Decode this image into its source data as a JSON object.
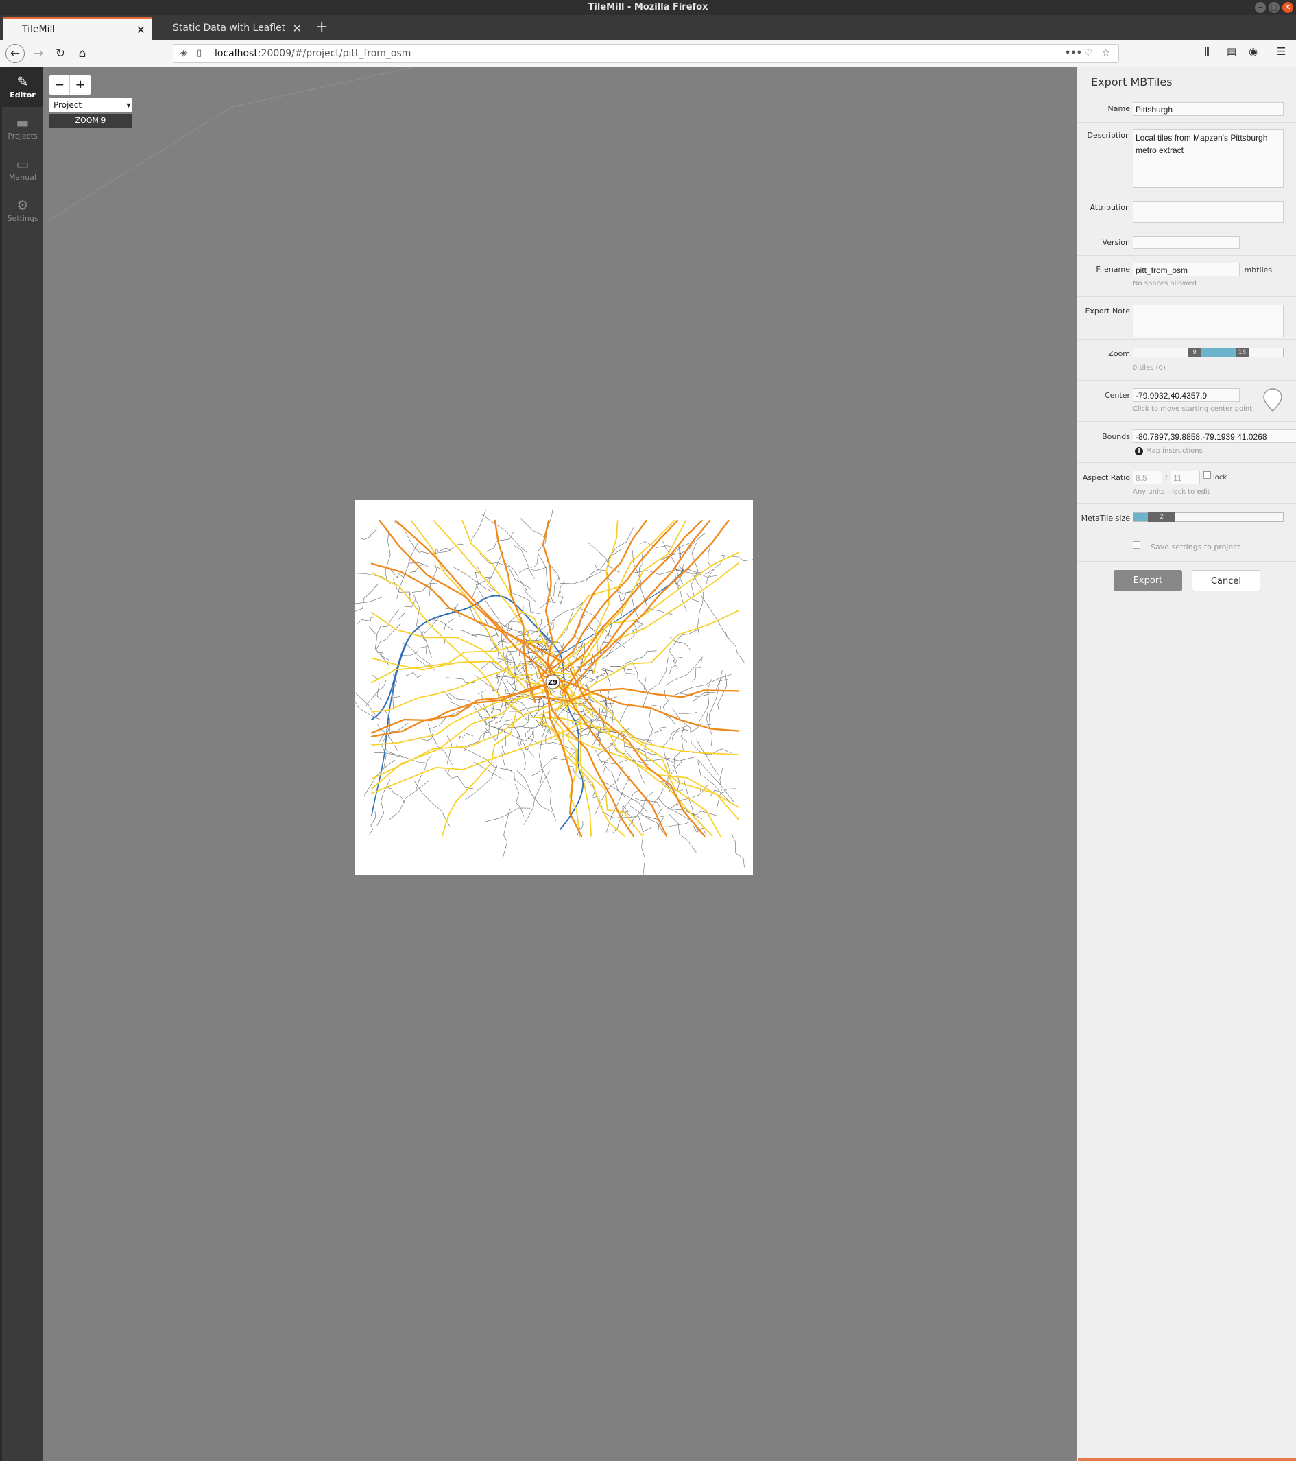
{
  "window": {
    "title": "TileMill - Mozilla Firefox"
  },
  "tabs": [
    {
      "label": "TileMill",
      "active": true
    },
    {
      "label": "Static Data with Leaflet",
      "active": false
    }
  ],
  "url": {
    "host": "localhost",
    "path": ":20009/#/project/pitt_from_osm"
  },
  "sidebar": {
    "items": [
      {
        "label": "Editor",
        "icon": "pencil-icon"
      },
      {
        "label": "Projects",
        "icon": "folder-icon"
      },
      {
        "label": "Manual",
        "icon": "book-icon"
      },
      {
        "label": "Settings",
        "icon": "gear-icon"
      }
    ]
  },
  "map": {
    "project_select": "Project",
    "zoom_label": "ZOOM 9",
    "center_marker": "Z9",
    "colors": {
      "background": "#808080",
      "motorway": "#f08a1e",
      "primary": "#f7d12a",
      "water": "#2f6fb8",
      "minor": "#666666"
    }
  },
  "export": {
    "title": "Export MBTiles",
    "fields": {
      "name": {
        "label": "Name",
        "value": "Pittsburgh"
      },
      "description": {
        "label": "Description",
        "line1": "Local tiles from Mapzen's Pittsburgh",
        "line2": "metro extract"
      },
      "attribution": {
        "label": "Attribution",
        "value": ""
      },
      "version": {
        "label": "Version",
        "value": ""
      },
      "filename": {
        "label": "Filename",
        "value": "pitt_from_osm",
        "suffix": ".mbtiles",
        "note": "No spaces allowed"
      },
      "export_note": {
        "label": "Export Note",
        "value": ""
      },
      "zoom": {
        "label": "Zoom",
        "min": 9,
        "max": 16,
        "note": "0 tiles (0)",
        "scale_min": 0,
        "scale_max": 22
      },
      "center": {
        "label": "Center",
        "value": "-79.9932,40.4357,9",
        "note": "Click to move starting center point."
      },
      "bounds": {
        "label": "Bounds",
        "value": "-80.7897,39.8858,-79.1939,41.0268",
        "note": "Map instructions"
      },
      "aspect_ratio": {
        "label": "Aspect Ratio",
        "width": "8.5",
        "height": "11",
        "lock_label": "lock",
        "note": "Any units - lock to edit"
      },
      "metatile": {
        "label": "MetaTile size",
        "value": 2,
        "scale_max": 16
      }
    },
    "save_settings_label": "Save settings to project",
    "export_button": "Export",
    "cancel_button": "Cancel"
  }
}
